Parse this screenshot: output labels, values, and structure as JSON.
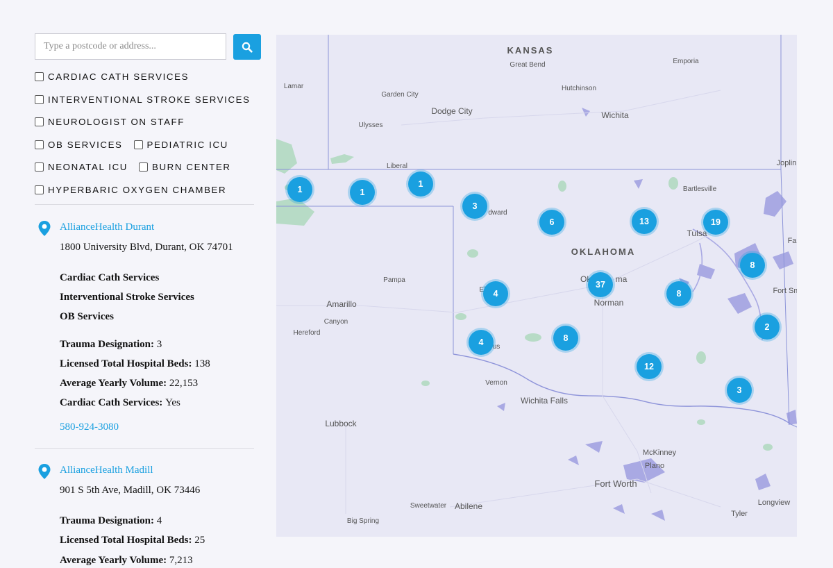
{
  "search": {
    "placeholder": "Type a postcode or address...",
    "button_icon": "search-icon"
  },
  "filters": [
    [
      "Cardiac Cath Services"
    ],
    [
      "Interventional Stroke Services"
    ],
    [
      "Neurologist on Staff"
    ],
    [
      "OB Services",
      "Pediatric ICU"
    ],
    [
      "Neonatal ICU",
      "Burn Center"
    ],
    [
      "Hyperbaric Oxygen Chamber"
    ]
  ],
  "hospitals": [
    {
      "name": "AllianceHealth Durant",
      "address": "1800 University Blvd, Durant, OK 74701",
      "services": [
        "Cardiac Cath Services",
        "Interventional Stroke Services",
        "OB Services"
      ],
      "stats": [
        {
          "label": "Trauma Designation:",
          "value": "3"
        },
        {
          "label": "Licensed Total Hospital Beds:",
          "value": "138"
        },
        {
          "label": "Average Yearly Volume:",
          "value": "22,153"
        },
        {
          "label": "Cardiac Cath Services:",
          "value": "Yes"
        }
      ],
      "phone": "580-924-3080"
    },
    {
      "name": "AllianceHealth Madill",
      "address": "901 S 5th Ave, Madill, OK 73446",
      "services": [],
      "stats": [
        {
          "label": "Trauma Designation:",
          "value": "4"
        },
        {
          "label": "Licensed Total Hospital Beds:",
          "value": "25"
        },
        {
          "label": "Average Yearly Volume:",
          "value": "7,213"
        }
      ],
      "phone": ""
    }
  ],
  "map": {
    "colors": {
      "cluster": "#1aa0e0",
      "land": "#e8e8f5",
      "water": "#a9a9e3",
      "border": "#8b93d8",
      "park": "#b7dbc6"
    },
    "states": [
      "KANSAS",
      "OKLAHOMA"
    ],
    "cities": [
      "Great Bend",
      "Emporia",
      "Lamar",
      "Garden City",
      "Hutchinson",
      "Dodge City",
      "Wichita",
      "Ulysses",
      "Liberal",
      "Joplin",
      "Bartlesville",
      "dward",
      "Tulsa",
      "Fa",
      "Pampa",
      "Okl",
      "ma",
      "Amarillo",
      "Norman",
      "Fort Sm",
      "El",
      "Canyon",
      "Hereford",
      "us",
      "Vernon",
      "Wichita Falls",
      "Lubbock",
      "McKinney",
      "Plano",
      "Fort Worth",
      "Sweetwater",
      "Abilene",
      "Longview",
      "Tyler",
      "Big Spring"
    ],
    "clusters": [
      "1",
      "1",
      "1",
      "3",
      "6",
      "13",
      "19",
      "8",
      "37",
      "4",
      "8",
      "2",
      "4",
      "8",
      "12",
      "3"
    ]
  }
}
